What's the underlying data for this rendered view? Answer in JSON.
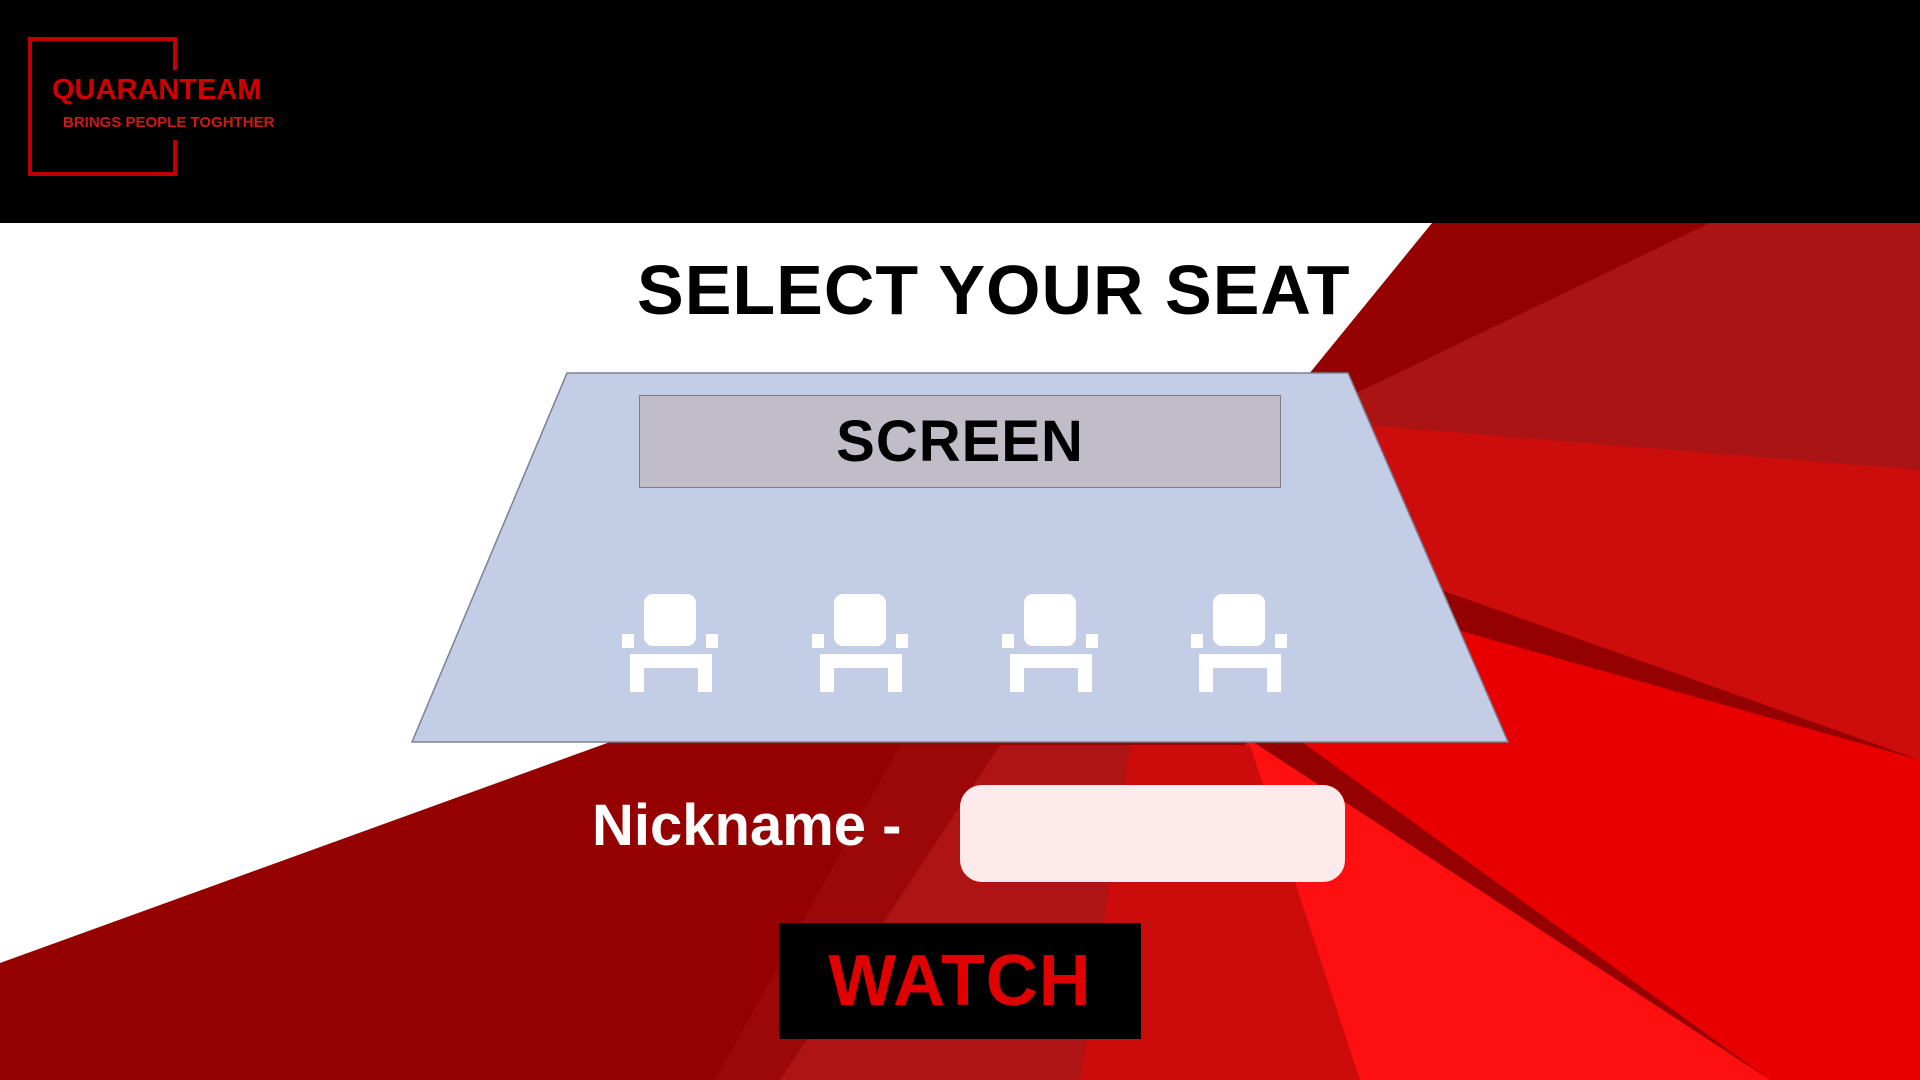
{
  "brand": {
    "name": "QUARANTEAM",
    "tagline": "BRINGS PEOPLE TOGHTHER"
  },
  "page": {
    "title": "SELECT YOUR SEAT"
  },
  "theater": {
    "screen_label": "SCREEN",
    "seats": [
      {
        "id": "seat-1",
        "icon": "seat-icon"
      },
      {
        "id": "seat-2",
        "icon": "seat-icon"
      },
      {
        "id": "seat-3",
        "icon": "seat-icon"
      },
      {
        "id": "seat-4",
        "icon": "seat-icon"
      }
    ]
  },
  "form": {
    "nickname_label": "Nickname -",
    "nickname_value": "",
    "nickname_placeholder": "",
    "watch_label": "WATCH"
  },
  "colors": {
    "brand_red": "#d00000",
    "header_bg": "#000000",
    "theater_floor": "#c4cde6",
    "screen_bg": "#c0bdc8",
    "input_bg": "#ffeaeb",
    "button_bg": "#000000",
    "button_text": "#e00000",
    "seat_fill": "#ffffff"
  }
}
